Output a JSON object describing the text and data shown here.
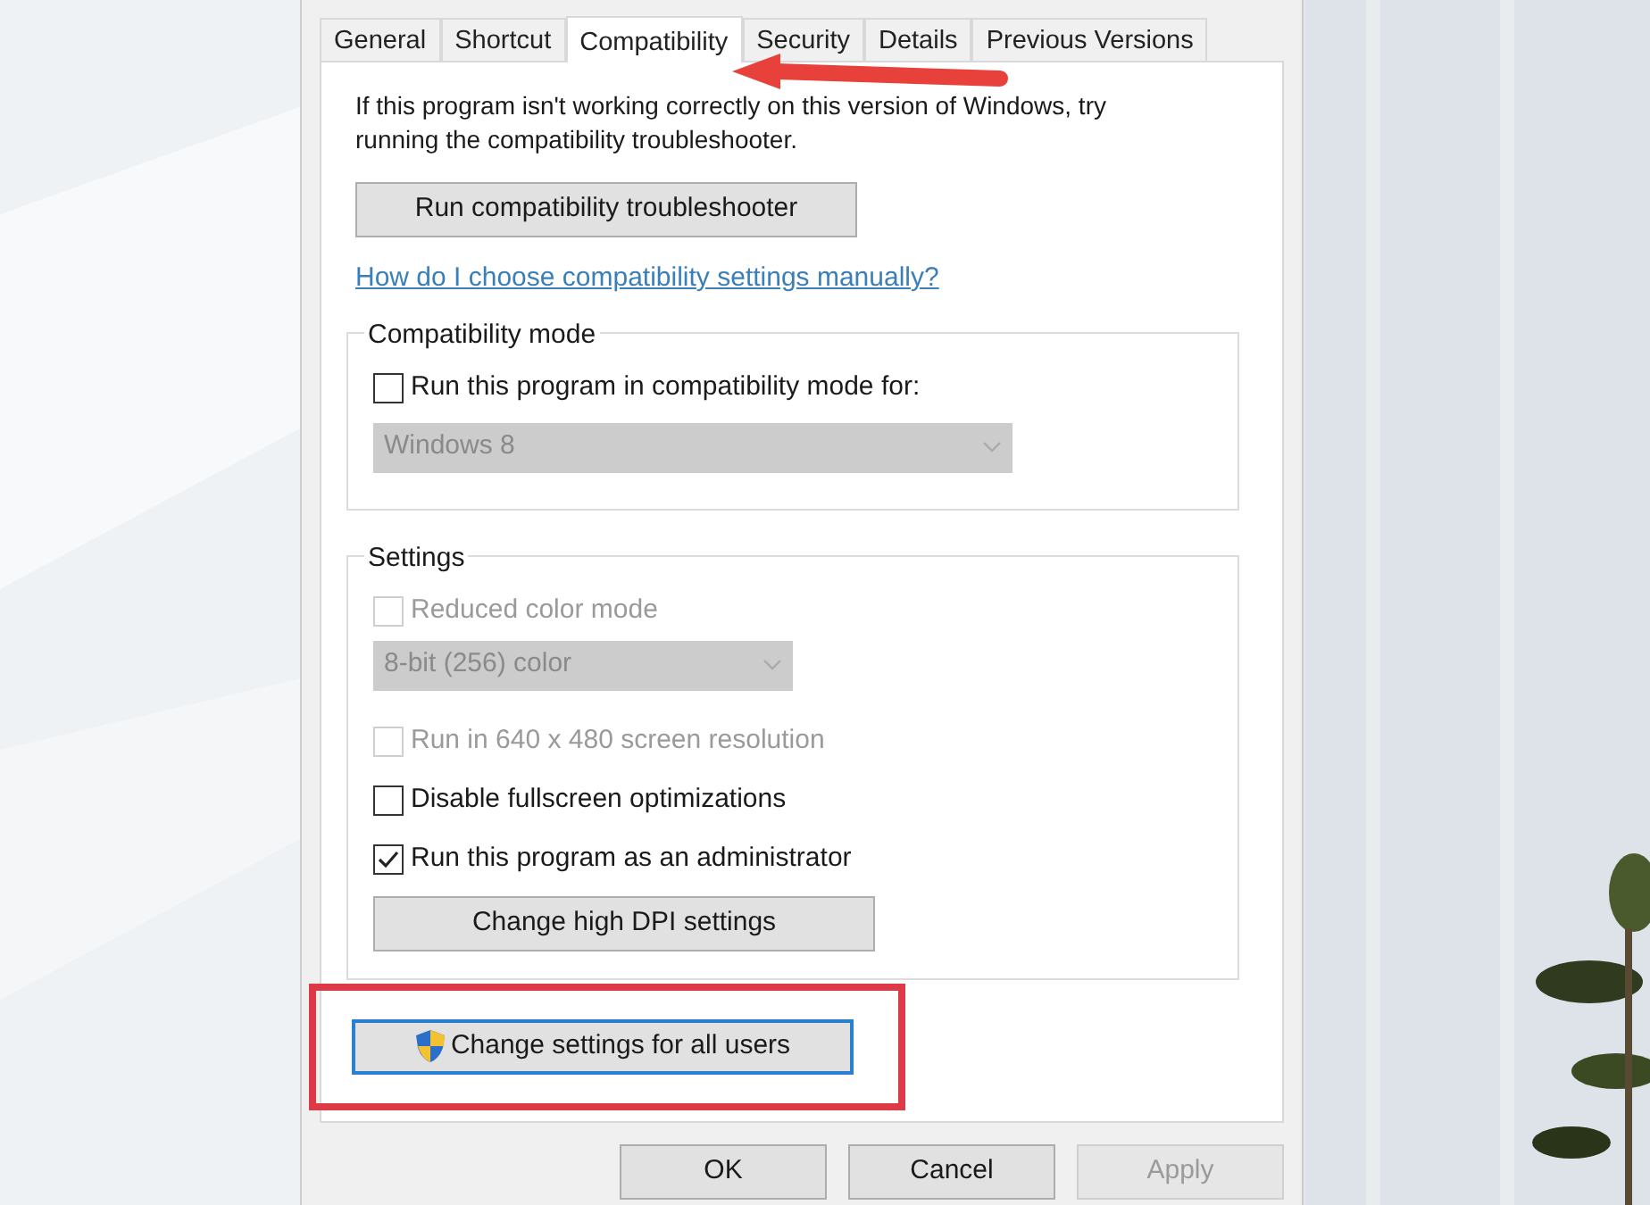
{
  "tabs": [
    {
      "label": "General",
      "selected": false
    },
    {
      "label": "Shortcut",
      "selected": false
    },
    {
      "label": "Compatibility",
      "selected": true
    },
    {
      "label": "Security",
      "selected": false
    },
    {
      "label": "Details",
      "selected": false
    },
    {
      "label": "Previous Versions",
      "selected": false
    }
  ],
  "intro": "If this program isn't working correctly on this version of Windows, try running the compatibility troubleshooter.",
  "troubleshooter_button": "Run compatibility troubleshooter",
  "help_link": "How do I choose compatibility settings manually?",
  "compatibility_mode": {
    "title": "Compatibility mode",
    "checkbox": {
      "label": "Run this program in compatibility mode for:",
      "checked": false,
      "disabled": false
    },
    "dropdown": {
      "value": "Windows 8",
      "disabled": true
    }
  },
  "settings": {
    "title": "Settings",
    "items": [
      {
        "kind": "checkbox",
        "label": "Reduced color mode",
        "checked": false,
        "disabled": true
      },
      {
        "kind": "dropdown",
        "value": "8-bit (256) color",
        "disabled": true
      },
      {
        "kind": "checkbox",
        "label": "Run in 640 x 480 screen resolution",
        "checked": false,
        "disabled": true
      },
      {
        "kind": "checkbox",
        "label": "Disable fullscreen optimizations",
        "checked": false,
        "disabled": false
      },
      {
        "kind": "checkbox",
        "label": "Run this program as an administrator",
        "checked": true,
        "disabled": false
      },
      {
        "kind": "button",
        "label": "Change high DPI settings"
      }
    ]
  },
  "all_users_button": {
    "label": "Change settings for all users",
    "highlighted": true
  },
  "footer_buttons": [
    {
      "label": "OK",
      "disabled": false
    },
    {
      "label": "Cancel",
      "disabled": false
    },
    {
      "label": "Apply",
      "disabled": true
    }
  ]
}
